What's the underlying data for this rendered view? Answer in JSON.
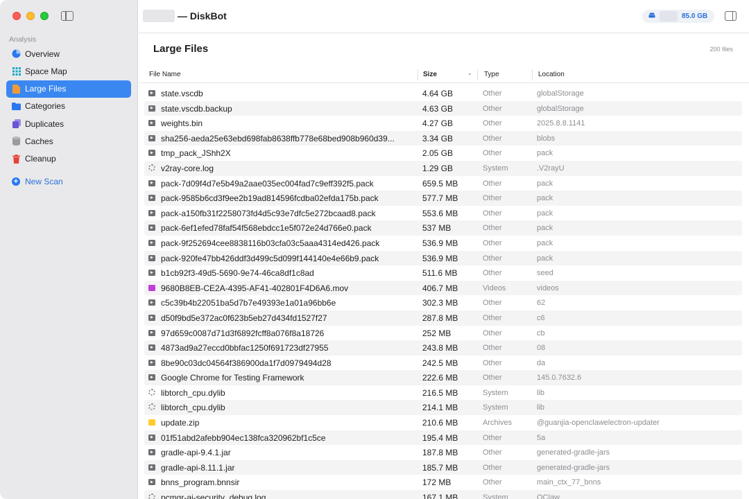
{
  "window": {
    "title": "— DiskBot"
  },
  "sidebar": {
    "section": "Analysis",
    "items": [
      {
        "label": "Overview",
        "icon": "pie-chart-icon",
        "active": false
      },
      {
        "label": "Space Map",
        "icon": "grid-icon",
        "active": false
      },
      {
        "label": "Large Files",
        "icon": "document-icon",
        "active": true
      },
      {
        "label": "Categories",
        "icon": "folder-icon",
        "active": false
      },
      {
        "label": "Duplicates",
        "icon": "duplicate-icon",
        "active": false
      },
      {
        "label": "Caches",
        "icon": "cylinder-icon",
        "active": false
      },
      {
        "label": "Cleanup",
        "icon": "trash-icon",
        "active": false
      }
    ],
    "new_scan": "New Scan"
  },
  "toolbar": {
    "disk_free": "85.0 GB"
  },
  "main": {
    "title": "Large Files",
    "count": "200 files",
    "columns": [
      "File Name",
      "Size",
      "Type",
      "Location"
    ],
    "rows": [
      {
        "name": "state.vscdb",
        "size": "4.64 GB",
        "type": "Other",
        "location": "globalStorage",
        "icon": "folder"
      },
      {
        "name": "state.vscdb.backup",
        "size": "4.63 GB",
        "type": "Other",
        "location": "globalStorage",
        "icon": "folder"
      },
      {
        "name": "weights.bin",
        "size": "4.27 GB",
        "type": "Other",
        "location": "2025.8.8.1141",
        "icon": "folder"
      },
      {
        "name": "sha256-aeda25e63ebd698fab8638ffb778e68bed908b960d39...",
        "size": "3.34 GB",
        "type": "Other",
        "location": "blobs",
        "icon": "folder"
      },
      {
        "name": "tmp_pack_JShh2X",
        "size": "2.05 GB",
        "type": "Other",
        "location": "pack",
        "icon": "folder"
      },
      {
        "name": "v2ray-core.log",
        "size": "1.29 GB",
        "type": "System",
        "location": ".V2rayU",
        "icon": "gear"
      },
      {
        "name": "pack-7d09f4d7e5b49a2aae035ec004fad7c9eff392f5.pack",
        "size": "659.5 MB",
        "type": "Other",
        "location": "pack",
        "icon": "folder"
      },
      {
        "name": "pack-9585b6cd3f9ee2b19ad814596fcdba02efda175b.pack",
        "size": "577.7 MB",
        "type": "Other",
        "location": "pack",
        "icon": "folder"
      },
      {
        "name": "pack-a150fb31f2258073fd4d5c93e7dfc5e272bcaad8.pack",
        "size": "553.6 MB",
        "type": "Other",
        "location": "pack",
        "icon": "folder"
      },
      {
        "name": "pack-6ef1efed78faf54f568ebdcc1e5f072e24d766e0.pack",
        "size": "537 MB",
        "type": "Other",
        "location": "pack",
        "icon": "folder"
      },
      {
        "name": "pack-9f252694cee8838116b03cfa03c5aaa4314ed426.pack",
        "size": "536.9 MB",
        "type": "Other",
        "location": "pack",
        "icon": "folder"
      },
      {
        "name": "pack-920fe47bb426ddf3d499c5d099f144140e4e66b9.pack",
        "size": "536.9 MB",
        "type": "Other",
        "location": "pack",
        "icon": "folder"
      },
      {
        "name": "b1cb92f3-49d5-5690-9e74-46ca8df1c8ad",
        "size": "511.6 MB",
        "type": "Other",
        "location": "seed",
        "icon": "folder"
      },
      {
        "name": "9680B8EB-CE2A-4395-AF41-402801F4D6A6.mov",
        "size": "406.7 MB",
        "type": "Videos",
        "location": "videos",
        "icon": "video"
      },
      {
        "name": "c5c39b4b22051ba5d7b7e49393e1a01a96bb6e",
        "size": "302.3 MB",
        "type": "Other",
        "location": "62",
        "icon": "folder"
      },
      {
        "name": "d50f9bd5e372ac0f623b5eb27d434fd1527f27",
        "size": "287.8 MB",
        "type": "Other",
        "location": "c6",
        "icon": "folder"
      },
      {
        "name": "97d659c0087d71d3f6892fcff8a076f8a18726",
        "size": "252 MB",
        "type": "Other",
        "location": "cb",
        "icon": "folder"
      },
      {
        "name": "4873ad9a27eccd0bbfac1250f691723df27955",
        "size": "243.8 MB",
        "type": "Other",
        "location": "08",
        "icon": "folder"
      },
      {
        "name": "8be90c03dc04564f386900da1f7d0979494d28",
        "size": "242.5 MB",
        "type": "Other",
        "location": "da",
        "icon": "folder"
      },
      {
        "name": "Google Chrome for Testing Framework",
        "size": "222.6 MB",
        "type": "Other",
        "location": "145.0.7632.6",
        "icon": "folder"
      },
      {
        "name": "libtorch_cpu.dylib",
        "size": "216.5 MB",
        "type": "System",
        "location": "lib",
        "icon": "gear"
      },
      {
        "name": "libtorch_cpu.dylib",
        "size": "214.1 MB",
        "type": "System",
        "location": "lib",
        "icon": "gear"
      },
      {
        "name": "update.zip",
        "size": "210.6 MB",
        "type": "Archives",
        "location": "@guanjia-openclawelectron-updater",
        "icon": "zip"
      },
      {
        "name": "01f51abd2afebb904ec138fca320962bf1c5ce",
        "size": "195.4 MB",
        "type": "Other",
        "location": "5a",
        "icon": "folder"
      },
      {
        "name": "gradle-api-9.4.1.jar",
        "size": "187.8 MB",
        "type": "Other",
        "location": "generated-gradle-jars",
        "icon": "folder"
      },
      {
        "name": "gradle-api-8.11.1.jar",
        "size": "185.7 MB",
        "type": "Other",
        "location": "generated-gradle-jars",
        "icon": "folder"
      },
      {
        "name": "bnns_program.bnnsir",
        "size": "172 MB",
        "type": "Other",
        "location": "main_ctx_77_bnns",
        "icon": "folder"
      },
      {
        "name": "pcmgr-ai-security_debug.log",
        "size": "167.1 MB",
        "type": "System",
        "location": "QClaw",
        "icon": "gear"
      }
    ]
  }
}
